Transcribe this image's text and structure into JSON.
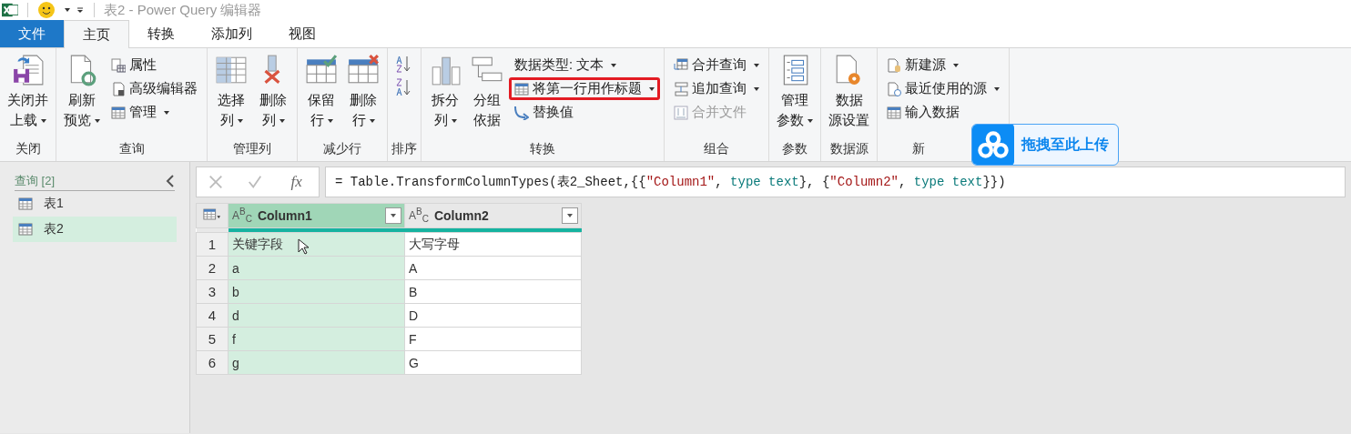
{
  "window": {
    "title": "表2 - Power Query 编辑器"
  },
  "tabs": [
    {
      "label": "文件",
      "kind": "file",
      "selected": false
    },
    {
      "label": "主页",
      "kind": "tab",
      "selected": true
    },
    {
      "label": "转换",
      "kind": "tab",
      "selected": false
    },
    {
      "label": "添加列",
      "kind": "tab",
      "selected": false
    },
    {
      "label": "视图",
      "kind": "tab",
      "selected": false
    }
  ],
  "ribbon": [
    {
      "label": "关闭",
      "items": [
        {
          "kind": "large",
          "lines": [
            "关闭并",
            "上载"
          ],
          "dropdown": true
        }
      ]
    },
    {
      "label": "查询",
      "items": [
        {
          "kind": "large",
          "lines": [
            "刷新",
            "预览"
          ],
          "dropdown": true
        },
        {
          "kind": "stack",
          "children": [
            {
              "label": "属性",
              "dropdown": false,
              "disabled": false,
              "highlighted": false
            },
            {
              "label": "高级编辑器",
              "dropdown": false,
              "disabled": false,
              "highlighted": false
            },
            {
              "label": "管理",
              "dropdown": true,
              "disabled": false,
              "highlighted": false
            }
          ]
        }
      ]
    },
    {
      "label": "管理列",
      "items": [
        {
          "kind": "large",
          "lines": [
            "选择",
            "列"
          ],
          "dropdown": true
        },
        {
          "kind": "large",
          "lines": [
            "删除",
            "列"
          ],
          "dropdown": true
        }
      ]
    },
    {
      "label": "减少行",
      "items": [
        {
          "kind": "large",
          "lines": [
            "保留",
            "行"
          ],
          "dropdown": true
        },
        {
          "kind": "large",
          "lines": [
            "删除",
            "行"
          ],
          "dropdown": true
        }
      ]
    },
    {
      "label": "排序",
      "items": [
        {
          "kind": "icons",
          "buttons": [
            {
              "kind": "ascending"
            },
            {
              "kind": "descending"
            }
          ]
        }
      ]
    },
    {
      "label": "转换",
      "items": [
        {
          "kind": "large",
          "lines": [
            "拆分",
            "列"
          ],
          "dropdown": true
        },
        {
          "kind": "large",
          "lines": [
            "分组",
            "依据"
          ],
          "dropdown": false
        },
        {
          "kind": "stack",
          "children": [
            {
              "label": "数据类型: 文本",
              "dropdown": true,
              "disabled": false,
              "highlighted": false
            },
            {
              "label": "将第一行用作标题",
              "dropdown": true,
              "disabled": false,
              "highlighted": true
            },
            {
              "label": "替换值",
              "dropdown": false,
              "disabled": false,
              "highlighted": false
            }
          ]
        }
      ]
    },
    {
      "label": "组合",
      "items": [
        {
          "kind": "stack",
          "children": [
            {
              "label": "合并查询",
              "dropdown": true,
              "disabled": false,
              "highlighted": false
            },
            {
              "label": "追加查询",
              "dropdown": true,
              "disabled": false,
              "highlighted": false
            },
            {
              "label": "合并文件",
              "dropdown": false,
              "disabled": true,
              "highlighted": false
            }
          ]
        }
      ]
    },
    {
      "label": "参数",
      "items": [
        {
          "kind": "large",
          "lines": [
            "管理",
            "参数"
          ],
          "dropdown": true
        }
      ]
    },
    {
      "label": "数据源",
      "items": [
        {
          "kind": "large",
          "lines": [
            "数据",
            "源设置"
          ],
          "dropdown": false
        }
      ]
    },
    {
      "label": "新",
      "items": [
        {
          "kind": "stack",
          "children": [
            {
              "label": "新建源",
              "dropdown": true,
              "disabled": false,
              "highlighted": false
            },
            {
              "label": "最近使用的源",
              "dropdown": true,
              "disabled": false,
              "highlighted": false
            },
            {
              "label": "输入数据",
              "dropdown": false,
              "disabled": false,
              "highlighted": false
            }
          ]
        }
      ]
    }
  ],
  "upload_popup": {
    "label": "拖拽至此上传"
  },
  "queries": {
    "header": "查询 [2]",
    "items": [
      {
        "label": "表1",
        "selected": false
      },
      {
        "label": "表2",
        "selected": true
      }
    ]
  },
  "formula": {
    "fx": "fx",
    "tokens": [
      {
        "text": "= Table.TransformColumnTypes(表2_Sheet,{{",
        "kind": "plain"
      },
      {
        "text": "\"Column1\"",
        "kind": "string"
      },
      {
        "text": ", ",
        "kind": "plain"
      },
      {
        "text": "type text",
        "kind": "keyword"
      },
      {
        "text": "}, {",
        "kind": "plain"
      },
      {
        "text": "\"Column2\"",
        "kind": "string"
      },
      {
        "text": ", ",
        "kind": "plain"
      },
      {
        "text": "type text",
        "kind": "keyword"
      },
      {
        "text": "}})",
        "kind": "plain"
      }
    ]
  },
  "table": {
    "columns": [
      {
        "type": "A$^{B}$$_{C}$",
        "name": "Column1",
        "selected": true
      },
      {
        "type": "A$^{B}$$_{C}$",
        "name": "Column2",
        "selected": false
      }
    ],
    "rows": [
      {
        "num": "1",
        "cells": [
          "关键字段",
          "大写字母"
        ]
      },
      {
        "num": "2",
        "cells": [
          "a",
          "A"
        ]
      },
      {
        "num": "3",
        "cells": [
          "b",
          "B"
        ]
      },
      {
        "num": "4",
        "cells": [
          "d",
          "D"
        ]
      },
      {
        "num": "5",
        "cells": [
          "f",
          "F"
        ]
      },
      {
        "num": "6",
        "cells": [
          "g",
          "G"
        ]
      }
    ]
  }
}
